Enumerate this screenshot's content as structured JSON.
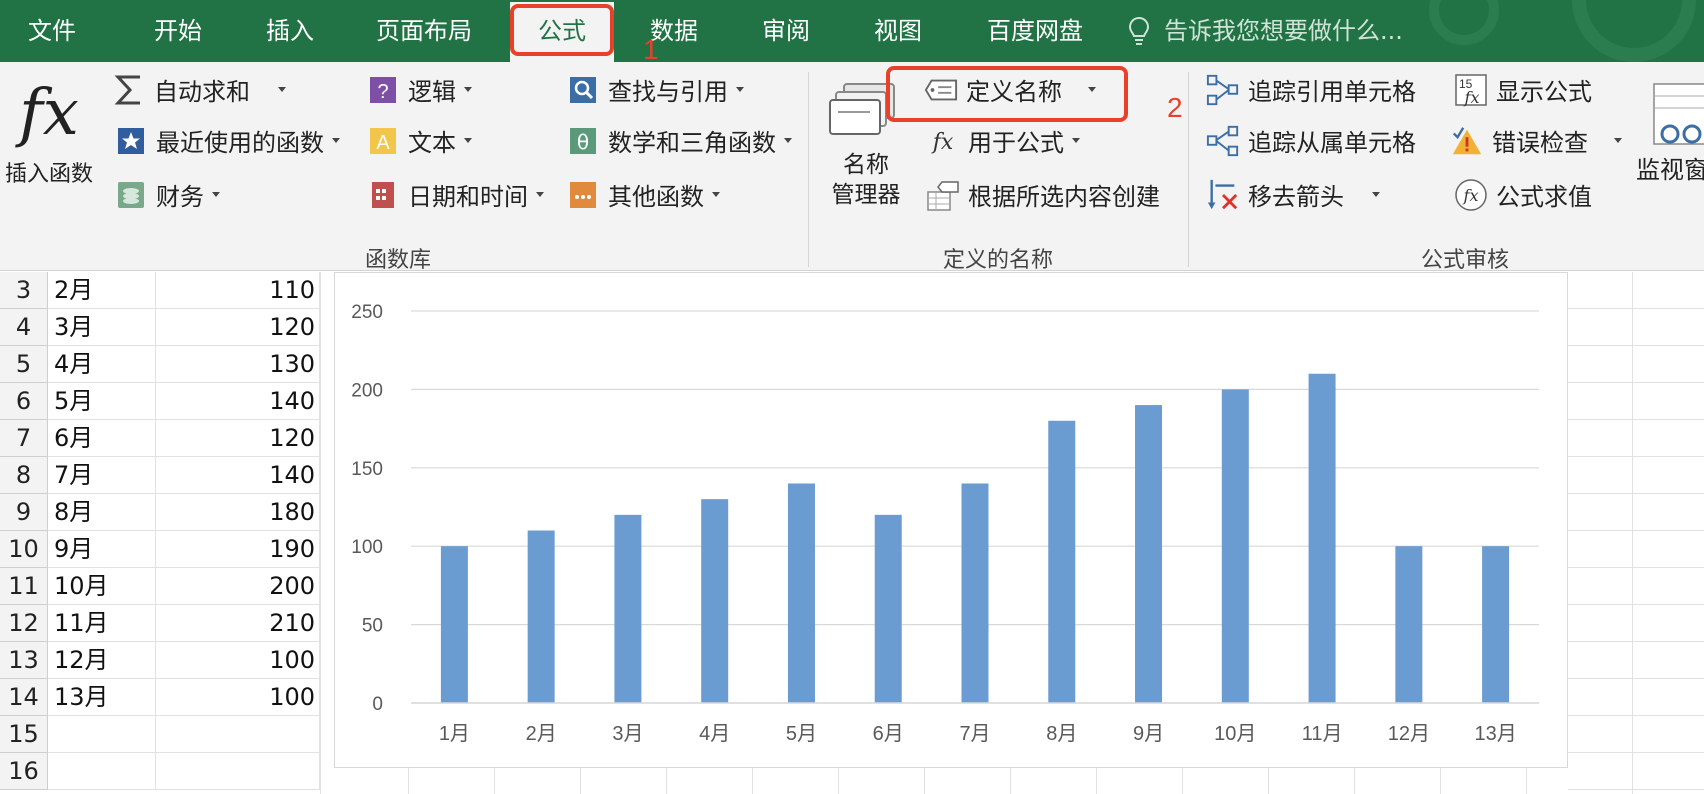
{
  "tabs": [
    {
      "label": "文件",
      "name": "tab-file"
    },
    {
      "label": "开始",
      "name": "tab-home"
    },
    {
      "label": "插入",
      "name": "tab-insert"
    },
    {
      "label": "页面布局",
      "name": "tab-page-layout"
    },
    {
      "label": "公式",
      "name": "tab-formulas",
      "active": true
    },
    {
      "label": "数据",
      "name": "tab-data"
    },
    {
      "label": "审阅",
      "name": "tab-review"
    },
    {
      "label": "视图",
      "name": "tab-view"
    },
    {
      "label": "百度网盘",
      "name": "tab-baidu-netdisk"
    }
  ],
  "tell_me": "告诉我您想要做什么...",
  "ribbon": {
    "insert_function": {
      "symbol": "fx",
      "label": "插入函数"
    },
    "function_library": {
      "label": "函数库",
      "autosum": "自动求和",
      "recent": "最近使用的函数",
      "financial": "财务",
      "logical": "逻辑",
      "text": "文本",
      "datetime": "日期和时间",
      "lookup": "查找与引用",
      "math": "数学和三角函数",
      "more": "其他函数"
    },
    "defined_names": {
      "label": "定义的名称",
      "name_manager_line1": "名称",
      "name_manager_line2": "管理器",
      "define_name": "定义名称",
      "use_in_formula": "用于公式",
      "create_from_selection": "根据所选内容创建"
    },
    "formula_auditing": {
      "label": "公式审核",
      "trace_precedents": "追踪引用单元格",
      "trace_dependents": "追踪从属单元格",
      "remove_arrows": "移去箭头",
      "show_formulas": "显示公式",
      "error_checking": "错误检查",
      "evaluate_formula": "公式求值",
      "watch_window": "监视窗"
    }
  },
  "annotations": {
    "step1": "1",
    "step2": "2",
    "color": "#e8412a"
  },
  "sheet": {
    "rows": [
      {
        "num": "3",
        "month": "2月",
        "value": "110"
      },
      {
        "num": "4",
        "month": "3月",
        "value": "120"
      },
      {
        "num": "5",
        "month": "4月",
        "value": "130"
      },
      {
        "num": "6",
        "month": "5月",
        "value": "140"
      },
      {
        "num": "7",
        "month": "6月",
        "value": "120"
      },
      {
        "num": "8",
        "month": "7月",
        "value": "140"
      },
      {
        "num": "9",
        "month": "8月",
        "value": "180"
      },
      {
        "num": "10",
        "month": "9月",
        "value": "190"
      },
      {
        "num": "11",
        "month": "10月",
        "value": "200"
      },
      {
        "num": "12",
        "month": "11月",
        "value": "210"
      },
      {
        "num": "13",
        "month": "12月",
        "value": "100"
      },
      {
        "num": "14",
        "month": "13月",
        "value": "100"
      },
      {
        "num": "15",
        "month": "",
        "value": ""
      },
      {
        "num": "16",
        "month": "",
        "value": ""
      }
    ]
  },
  "chart_data": {
    "type": "bar",
    "categories": [
      "1月",
      "2月",
      "3月",
      "4月",
      "5月",
      "6月",
      "7月",
      "8月",
      "9月",
      "10月",
      "11月",
      "12月",
      "13月"
    ],
    "values": [
      100,
      110,
      120,
      130,
      140,
      120,
      140,
      180,
      190,
      200,
      210,
      100,
      100
    ],
    "ylim": [
      0,
      250
    ],
    "yticks": [
      "0",
      "50",
      "100",
      "150",
      "200",
      "250"
    ],
    "grid": true,
    "bar_color": "#6a9bd1",
    "title": "",
    "xlabel": "",
    "ylabel": ""
  },
  "colors": {
    "excel_green": "#217346",
    "ribbon_bg": "#f3f3f3"
  }
}
